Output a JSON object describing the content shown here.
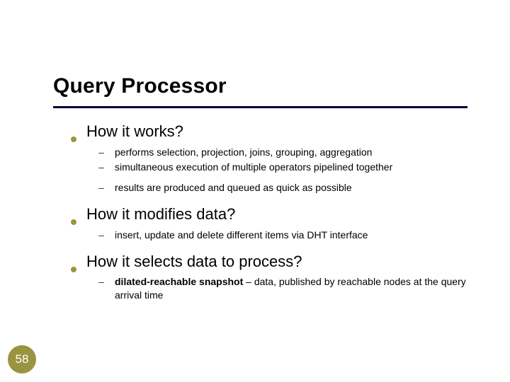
{
  "title": "Query Processor",
  "page_number": "58",
  "colors": {
    "accent": "#9a9440",
    "underline": "#000033"
  },
  "sections": [
    {
      "heading": "How it works?",
      "items": [
        "performs selection, projection, joins, grouping, aggregation",
        "simultaneous execution of multiple operators pipelined together",
        "results are produced and queued as quick as possible"
      ]
    },
    {
      "heading": "How it modifies data?",
      "items": [
        "insert, update and delete different items via DHT interface"
      ]
    },
    {
      "heading": "How it selects data to process?",
      "items": [
        {
          "bold": "dilated-reachable snapshot",
          "rest": " – data, published by reachable nodes at the query arrival time"
        }
      ]
    }
  ]
}
